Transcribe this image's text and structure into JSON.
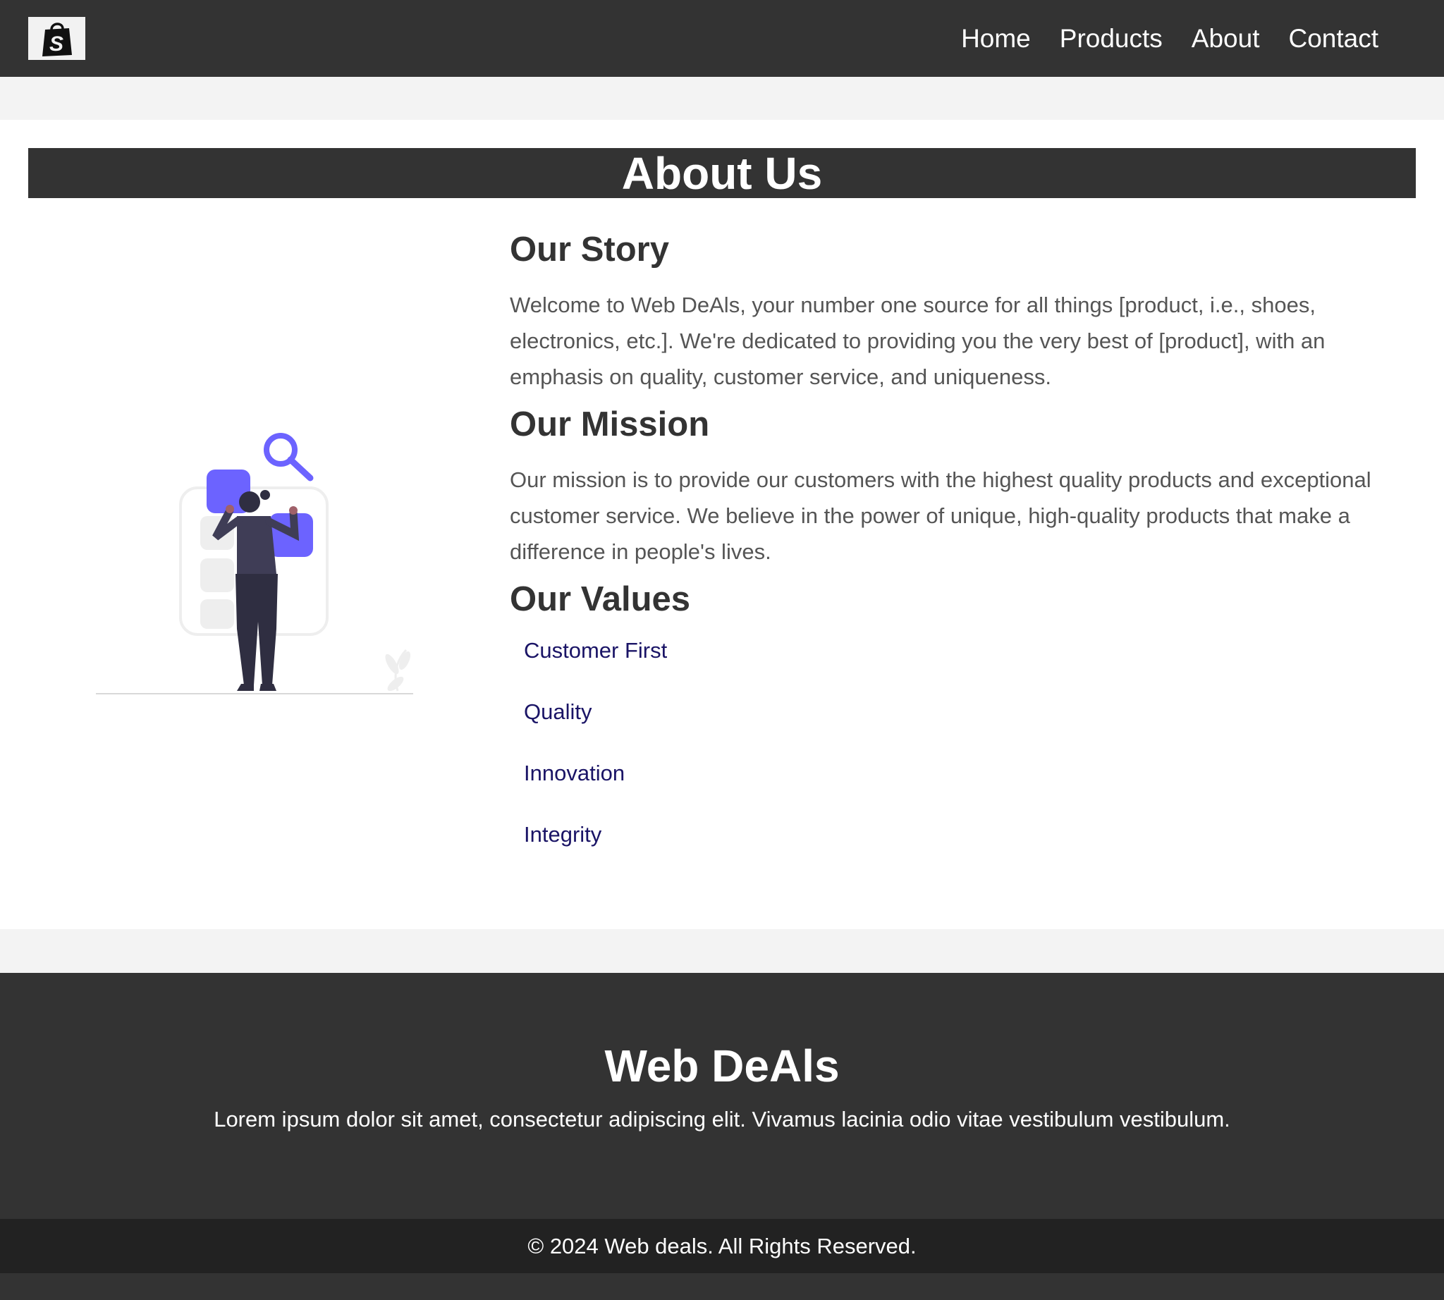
{
  "header": {
    "logo_icon": "shopping-bag-icon",
    "nav": [
      "Home",
      "Products",
      "About",
      "Contact"
    ]
  },
  "main": {
    "title": "About Us",
    "story": {
      "heading": "Our Story",
      "text": "Welcome to Web DeAls, your number one source for all things [product, i.e., shoes, electronics, etc.]. We're dedicated to providing you the very best of [product], with an emphasis on quality, customer service, and uniqueness."
    },
    "mission": {
      "heading": "Our Mission",
      "text": "Our mission is to provide our customers with the highest quality products and exceptional customer service. We believe in the power of unique, high-quality products that make a difference in people's lives."
    },
    "values": {
      "heading": "Our Values",
      "items": [
        "Customer First",
        "Quality",
        "Innovation",
        "Integrity"
      ]
    }
  },
  "footer": {
    "brand": "Web DeAls",
    "text": "Lorem ipsum dolor sit amet, consectetur adipiscing elit. Vivamus lacinia odio vitae vestibulum vestibulum.",
    "copyright": "© 2024 Web deals. All Rights Reserved."
  },
  "colors": {
    "header_bg": "#333333",
    "accent": "#6c63ff",
    "value_text": "#1a1466",
    "page_bg": "#f3f3f3"
  }
}
